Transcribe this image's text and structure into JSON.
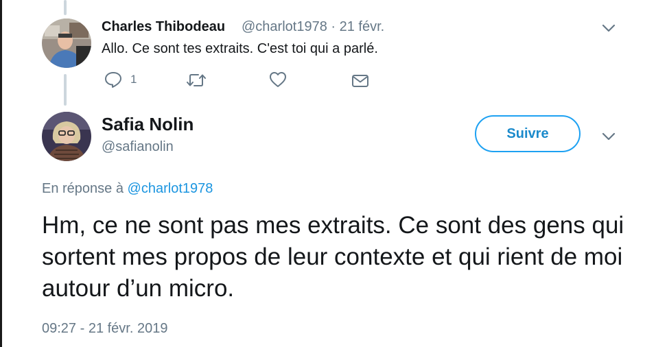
{
  "reply_tweet": {
    "author_name": "Charles Thibodeau",
    "author_handle": "@charlot1978",
    "separator": "·",
    "date": "21 févr.",
    "text": "Allo. Ce sont tes extraits. C'est toi qui a parlé.",
    "reply_count": "1",
    "icons": [
      "reply-icon",
      "retweet-icon",
      "like-icon",
      "message-icon",
      "chevron-down-icon"
    ]
  },
  "main_tweet": {
    "author_name": "Safia Nolin",
    "author_handle": "@safianolin",
    "follow_label": "Suivre",
    "reply_prefix": "En réponse à",
    "reply_to_handle": "@charlot1978",
    "text": "Hm, ce ne sont pas mes extraits. Ce sont des gens qui sortent mes propos de leur contexte et qui rient de moi autour d’un micro.",
    "timestamp": "09:27 - 21 févr. 2019"
  },
  "colors": {
    "accent": "#1da1f2",
    "muted": "#657786",
    "text": "#14171a",
    "thread_line": "#ccd6dd"
  }
}
